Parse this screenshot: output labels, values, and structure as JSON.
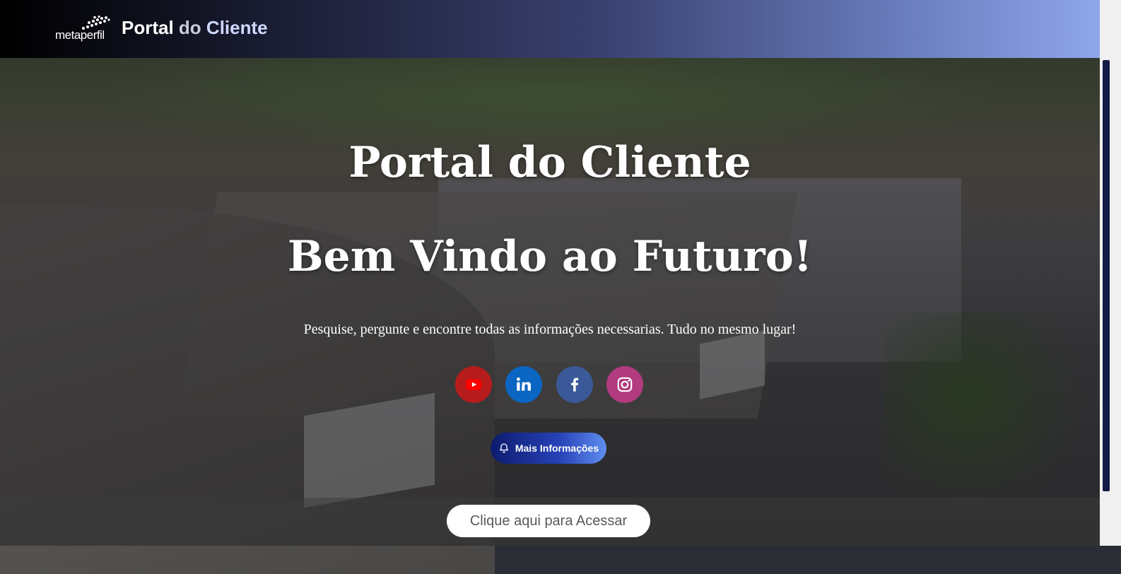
{
  "header": {
    "logo_text": "metaperfil",
    "title_part1": "Portal",
    "title_part2": "do",
    "title_part3": "Cliente"
  },
  "hero": {
    "title_line1": "Portal do Cliente",
    "title_line2": "Bem Vindo ao Futuro!",
    "subtitle": "Pesquise, pergunte e encontre todas as informações necessarias. Tudo no mesmo lugar!"
  },
  "social": [
    {
      "name": "youtube",
      "icon": "youtube-icon",
      "color": "#b71c1c"
    },
    {
      "name": "linkedin",
      "icon": "linkedin-icon",
      "color": "#0a66c2"
    },
    {
      "name": "facebook",
      "icon": "facebook-icon",
      "color": "#3b5998"
    },
    {
      "name": "instagram",
      "icon": "instagram-icon",
      "color": "#b23a7f"
    }
  ],
  "buttons": {
    "more_info_label": "Mais Informações",
    "access_label": "Clique aqui para Acessar"
  },
  "colors": {
    "header_gradient_start": "#000000",
    "header_gradient_end": "#8fa6ea",
    "primary_blue": "#2743b8"
  }
}
